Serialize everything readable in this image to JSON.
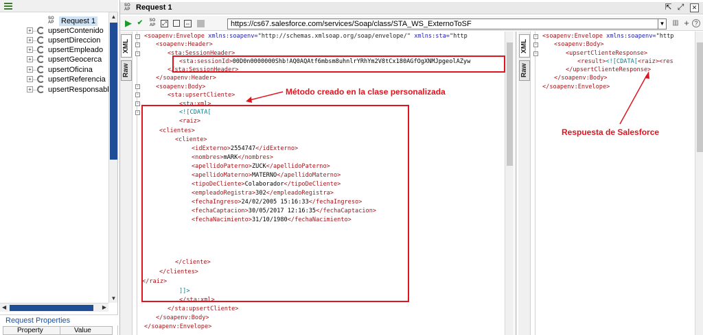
{
  "left_panel": {
    "toolbar_icon": "list-icon",
    "request_item": {
      "badge": "SO\nAP",
      "label": "Request 1"
    },
    "operations": [
      "upsertContenido",
      "upsertDireccion",
      "upsertEmpleado",
      "upsertGeocerca",
      "upsertOficina",
      "upsertReferencia",
      "upsertResponsableU"
    ],
    "properties_title": "Request Properties",
    "properties_columns": [
      "Property",
      "Value"
    ]
  },
  "window": {
    "badge": "SO\nAP",
    "title": "Request 1",
    "url": "https://cs67.salesforce.com/services/Soap/class/STA_WS_ExternoToSF",
    "tab_xml": "XML",
    "tab_raw": "Raw"
  },
  "request_xml": {
    "l1": {
      "tag": "<soapenv:Envelope",
      "a1": " xmlns:soapenv=",
      "v1": "\"http://schemas.xmlsoap.org/soap/envelope/\"",
      "a2": " xmlns:sta=",
      "v2": "\"http"
    },
    "l2": "<soapenv:Header>",
    "l3": "<sta:SessionHeader>",
    "l4": {
      "tag": "<sta:sessionId>",
      "txt": "00D0n0000000Shb!AQ0AQAtf6mbsm8uhnlrYRhYm2V8tCx180AGfOgXNMJpgeolAZyw"
    },
    "l5": "</sta:SessionHeader>",
    "l6": "</soapenv:Header>",
    "l7": "<soapenv:Body>",
    "l8": "<sta:upsertCliente>",
    "l9": "<sta:xml>",
    "l10": "<![CDATA[",
    "l11": "<raiz>",
    "l12": "<clientes>",
    "l13": "<cliente>",
    "l14": {
      "o": "<idExterno>",
      "v": "2554747",
      "c": "</idExterno>"
    },
    "l15": {
      "o": "<nombres>",
      "v": "mARK",
      "c": "</nombres>"
    },
    "l16": {
      "o": "<apellidoPaterno>",
      "v": "ZUCK",
      "c": "</apellidoPaterno>"
    },
    "l17": {
      "o": "<apellidoMaterno>",
      "v": "MATERNO",
      "c": "</apellidoMaterno>"
    },
    "l18": {
      "o": "<tipoDeCliente>",
      "v": "Colaborador",
      "c": "</tipoDeCliente>"
    },
    "l19": {
      "o": "<empleadoRegistra>",
      "v": "302",
      "c": "</empleadoRegistra>"
    },
    "l20": {
      "o": "<fechaIngreso>",
      "v": "24/02/2005 15:16:33",
      "c": "</fechaIngreso>"
    },
    "l21": {
      "o": "<fechaCaptacion>",
      "v": "30/05/2017 12:16:35",
      "c": "</fechaCaptacion>"
    },
    "l22": {
      "o": "<fechaNacimiento>",
      "v": "31/10/1980",
      "c": "</fechaNacimiento>"
    },
    "l23": "</cliente>",
    "l24": "</clientes>",
    "l25": "</raiz>",
    "l26": "]]>",
    "l27": "</sta:xml>",
    "l28": "</sta:upsertCliente>",
    "l29": "</soapenv:Body>",
    "l30": "</soapenv:Envelope>"
  },
  "response_xml": {
    "r1": {
      "tag": "<soapenv:Envelope",
      "a1": " xmlns:soapenv=",
      "v1": "\"http"
    },
    "r2": "<soapenv:Body>",
    "r3": "<upsertClienteResponse>",
    "r4": {
      "o": "<result>",
      "cd": "<![CDATA[",
      "raiz": "<raiz>",
      "cut": "<res"
    },
    "r5": "</upsertClienteResponse>",
    "r6": "</soapenv:Body>",
    "r7": "</soapenv:Envelope>"
  },
  "annotations": {
    "metodo": "Método creado en la clase personalizada",
    "respuesta": "Respuesta de Salesforce",
    "color": "#e0141e"
  }
}
